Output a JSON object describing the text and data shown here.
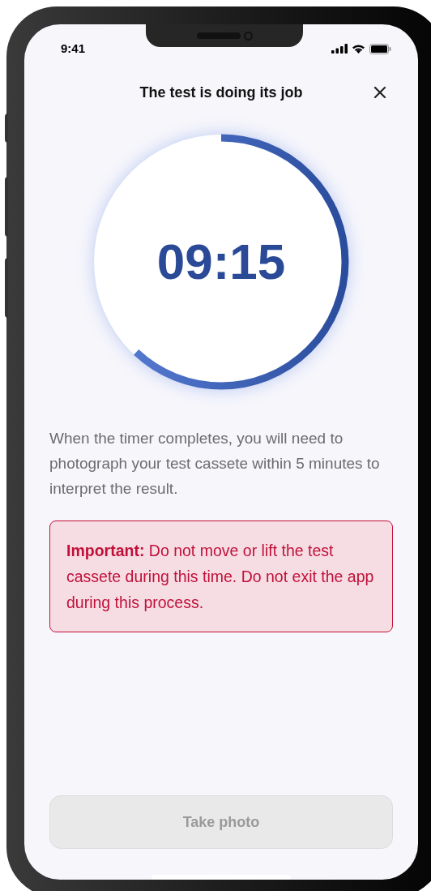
{
  "status_bar": {
    "time": "9:41"
  },
  "header": {
    "title": "The test is doing its job"
  },
  "timer": {
    "time": "09:15",
    "level": 0.62
  },
  "instructions": "When the timer completes, you will need to photograph your test cassete within 5 minutes to interpret the result.",
  "warning": "**Important:** Do not move or lift the test cassete during this time. Do not exit the app during this process.",
  "button": {
    "label": "Take photo",
    "disabled": true
  }
}
